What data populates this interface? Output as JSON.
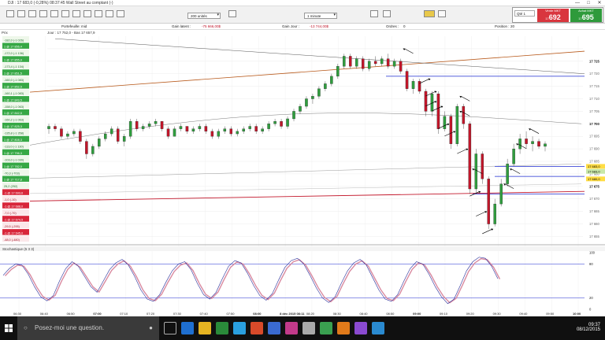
{
  "window": {
    "title": "DJI : 17 683,0 (-0,28%) 08:37:45 Wall Street au comptant (-)",
    "min": "—",
    "max": "□",
    "close": "✕"
  },
  "toolbar": {
    "units_select": "200 unités",
    "interval_select": "1 minute",
    "qty": "Qté 1",
    "sell_label": "Vente MKT",
    "sell_price": "692",
    "sell_prefix": "17",
    "buy_label": "Achat MKT",
    "buy_price": "695",
    "buy_prefix": "17"
  },
  "infobar": {
    "portfolio": "Portefeuille: mid",
    "gain_latent_label": "Gain latent :",
    "gain_latent": "-75 666,00$",
    "gain_jour_label": "Gain Jour :",
    "gain_jour": "-13 744,00$",
    "ordres_label": "Ordres :",
    "ordres": "0",
    "position_label": "Position :",
    "position": "20"
  },
  "chart_data": {
    "type": "candlestick",
    "title": "Jour : 17 752,0 - Bas 17 657,9",
    "y_axis_ticks": [
      "17 725",
      "17 700",
      "17 675",
      "17 650"
    ],
    "y_axis_minor": [
      "17 720",
      "17 715",
      "17 710",
      "17 705",
      "17 695",
      "17 690",
      "17 685",
      "17 680",
      "17 670",
      "17 665",
      "17 660",
      "17 655"
    ],
    "x_axis_ticks": [
      "06:30",
      "06:40",
      "06:50",
      "07:00",
      "07:10",
      "07:20",
      "07:30",
      "07:40",
      "07:50",
      "08:00",
      "8 déc 2015 08:11",
      "08:20",
      "08:30",
      "08:40",
      "08:50",
      "09:00",
      "09:10",
      "09:20",
      "09:30",
      "09:40",
      "09:50",
      "10:00"
    ],
    "ylim": [
      17652,
      17735
    ],
    "price_labels": [
      "17 683,0",
      "17 683,0",
      "17 680,0"
    ],
    "candles": [
      [
        0,
        17698,
        17700,
        17696,
        17699
      ],
      [
        1,
        17699,
        17700,
        17697,
        17698
      ],
      [
        2,
        17698,
        17699,
        17694,
        17695
      ],
      [
        3,
        17695,
        17697,
        17694,
        17696
      ],
      [
        4,
        17696,
        17698,
        17695,
        17697
      ],
      [
        5,
        17697,
        17698,
        17692,
        17693
      ],
      [
        6,
        17693,
        17694,
        17686,
        17688
      ],
      [
        7,
        17688,
        17692,
        17687,
        17691
      ],
      [
        8,
        17691,
        17695,
        17690,
        17694
      ],
      [
        9,
        17694,
        17697,
        17693,
        17696
      ],
      [
        10,
        17696,
        17699,
        17695,
        17698
      ],
      [
        11,
        17698,
        17699,
        17692,
        17693
      ],
      [
        12,
        17693,
        17696,
        17691,
        17695
      ],
      [
        13,
        17695,
        17702,
        17694,
        17701
      ],
      [
        14,
        17701,
        17702,
        17697,
        17698
      ],
      [
        15,
        17698,
        17700,
        17697,
        17699
      ],
      [
        16,
        17699,
        17701,
        17698,
        17700
      ],
      [
        17,
        17700,
        17702,
        17699,
        17701
      ],
      [
        18,
        17701,
        17701,
        17697,
        17698
      ],
      [
        19,
        17698,
        17699,
        17694,
        17695
      ],
      [
        20,
        17695,
        17699,
        17695,
        17698
      ],
      [
        21,
        17698,
        17700,
        17697,
        17699
      ],
      [
        22,
        17699,
        17699,
        17696,
        17697
      ],
      [
        23,
        17697,
        17699,
        17696,
        17698
      ],
      [
        24,
        17698,
        17700,
        17697,
        17699
      ],
      [
        25,
        17699,
        17700,
        17696,
        17697
      ],
      [
        26,
        17697,
        17698,
        17694,
        17695
      ],
      [
        27,
        17695,
        17698,
        17694,
        17697
      ],
      [
        28,
        17697,
        17699,
        17696,
        17698
      ],
      [
        29,
        17698,
        17699,
        17695,
        17696
      ],
      [
        30,
        17696,
        17698,
        17695,
        17697
      ],
      [
        31,
        17697,
        17699,
        17696,
        17698
      ],
      [
        32,
        17698,
        17700,
        17697,
        17699
      ],
      [
        33,
        17699,
        17700,
        17696,
        17697
      ],
      [
        34,
        17697,
        17699,
        17696,
        17698
      ],
      [
        35,
        17698,
        17701,
        17697,
        17700
      ],
      [
        36,
        17700,
        17702,
        17699,
        17701
      ],
      [
        37,
        17701,
        17702,
        17698,
        17699
      ],
      [
        38,
        17699,
        17703,
        17698,
        17702
      ],
      [
        39,
        17702,
        17706,
        17701,
        17705
      ],
      [
        40,
        17705,
        17708,
        17704,
        17707
      ],
      [
        41,
        17707,
        17711,
        17706,
        17710
      ],
      [
        42,
        17710,
        17712,
        17708,
        17711
      ],
      [
        43,
        17711,
        17715,
        17710,
        17714
      ],
      [
        44,
        17714,
        17717,
        17713,
        17716
      ],
      [
        45,
        17716,
        17720,
        17715,
        17719
      ],
      [
        46,
        17719,
        17724,
        17718,
        17723
      ],
      [
        47,
        17723,
        17728,
        17722,
        17727
      ],
      [
        48,
        17727,
        17728,
        17722,
        17723
      ],
      [
        49,
        17723,
        17727,
        17722,
        17726
      ],
      [
        50,
        17726,
        17727,
        17721,
        17722
      ],
      [
        51,
        17722,
        17726,
        17721,
        17725
      ],
      [
        52,
        17725,
        17727,
        17723,
        17724
      ],
      [
        53,
        17724,
        17727,
        17723,
        17726
      ],
      [
        54,
        17726,
        17728,
        17722,
        17723
      ],
      [
        55,
        17723,
        17726,
        17722,
        17725
      ],
      [
        56,
        17725,
        17726,
        17720,
        17721
      ],
      [
        57,
        17721,
        17722,
        17713,
        17714
      ],
      [
        58,
        17714,
        17718,
        17712,
        17717
      ],
      [
        59,
        17717,
        17718,
        17712,
        17713
      ],
      [
        60,
        17713,
        17714,
        17703,
        17705
      ],
      [
        61,
        17705,
        17713,
        17703,
        17712
      ],
      [
        62,
        17712,
        17713,
        17696,
        17698
      ],
      [
        63,
        17698,
        17705,
        17697,
        17703
      ],
      [
        64,
        17703,
        17704,
        17690,
        17692
      ],
      [
        65,
        17692,
        17708,
        17691,
        17707
      ],
      [
        66,
        17707,
        17708,
        17698,
        17700
      ],
      [
        67,
        17700,
        17701,
        17672,
        17674
      ],
      [
        68,
        17674,
        17690,
        17672,
        17688
      ],
      [
        69,
        17688,
        17689,
        17676,
        17678
      ],
      [
        70,
        17678,
        17679,
        17658,
        17660
      ],
      [
        71,
        17660,
        17670,
        17659,
        17668
      ],
      [
        72,
        17668,
        17678,
        17667,
        17676
      ],
      [
        73,
        17676,
        17686,
        17675,
        17684
      ],
      [
        74,
        17684,
        17692,
        17683,
        17690
      ],
      [
        75,
        17690,
        17696,
        17688,
        17694
      ],
      [
        76,
        17694,
        17697,
        17690,
        17692
      ],
      [
        77,
        17692,
        17695,
        17689,
        17693
      ],
      [
        78,
        17693,
        17694,
        17690,
        17691
      ],
      [
        79,
        17691,
        17693,
        17689,
        17692
      ]
    ]
  },
  "left_panel": {
    "header": "Prix",
    "rows": [
      [
        "-182,0",
        "(-1 026)",
        "g"
      ],
      [
        "1 @ 17 856,4",
        "",
        "gl"
      ],
      [
        "-172,0",
        "(-1 136)",
        "g"
      ],
      [
        "1 @ 17 855,9",
        "",
        "gl"
      ],
      [
        "-173,4",
        "(-1 134)",
        "g"
      ],
      [
        "1 @ 17 851,5",
        "",
        "gl"
      ],
      [
        "-160,0",
        "(-1 083)",
        "g"
      ],
      [
        "1 @ 17 852,5",
        "",
        "gl"
      ],
      [
        "-160,1",
        "(-1 083)",
        "g"
      ],
      [
        "1 @ 17 849,5",
        "",
        "gl"
      ],
      [
        "-158,0",
        "(-1 063)",
        "g"
      ],
      [
        "1 @ 17 842,5",
        "",
        "gl"
      ],
      [
        "-160,2",
        "(-1 063)",
        "g"
      ],
      [
        "1 @ 17 825,3",
        "",
        "gl"
      ],
      [
        "-135,8",
        "(-1 358)",
        "g"
      ],
      [
        "1 @ 17 808,3",
        "",
        "gl"
      ],
      [
        "-113,0",
        "(-1 130)",
        "g"
      ],
      [
        "1 @ 17 796,3",
        "",
        "gl"
      ],
      [
        "-103,0",
        "(-1 030)",
        "g"
      ],
      [
        "1 @ 17 782,0",
        "",
        "gl"
      ],
      [
        "-70,3",
        "(-703)",
        "g"
      ],
      [
        "1 @ 17 717,8",
        "",
        "gl"
      ],
      [
        "25,2",
        "(252)",
        "g"
      ],
      [
        "-1 @ 17 693,6",
        "",
        "rl"
      ],
      [
        "-1,0",
        "(-10)",
        "r"
      ],
      [
        "-1 @ 17 688,0",
        "",
        "rl"
      ],
      [
        "-7,0",
        "(-70)",
        "r"
      ],
      [
        "-1 @ 17 674,5",
        "",
        "rl"
      ],
      [
        "-29,5",
        "(-295)",
        "r"
      ],
      [
        "-1 @ 17 645,0",
        "",
        "rl"
      ],
      [
        "-48,0",
        "(-480)",
        "r"
      ]
    ]
  },
  "stoch": {
    "label": "Stochastique (5 3 3)",
    "ticks": [
      "100",
      "80",
      "20",
      "0"
    ],
    "values": [
      60,
      72,
      80,
      78,
      62,
      40,
      22,
      15,
      24,
      50,
      72,
      84,
      76,
      58,
      40,
      30,
      50,
      70,
      82,
      88,
      78,
      58,
      34,
      18,
      14,
      26,
      48,
      68,
      80,
      84,
      70,
      46,
      26,
      18,
      30,
      54,
      76,
      86,
      82,
      64,
      42,
      24,
      16,
      28,
      52,
      74,
      86,
      90,
      80,
      60,
      38,
      20,
      12,
      22,
      46,
      68,
      82,
      88,
      78,
      56,
      34,
      18,
      14,
      26,
      50,
      72,
      84,
      80,
      62,
      40,
      22,
      10,
      18,
      42,
      68,
      84,
      92,
      90,
      76,
      54
    ]
  },
  "taskbar": {
    "search_placeholder": "Posez-moi une question.",
    "time": "09:37",
    "date": "08/12/2015"
  },
  "colors": {
    "bull": "#2f9e3e",
    "bear": "#c2162a",
    "support": "#1e2bd0",
    "trend": "#b85a1c",
    "ma": "#7a7a7a"
  }
}
